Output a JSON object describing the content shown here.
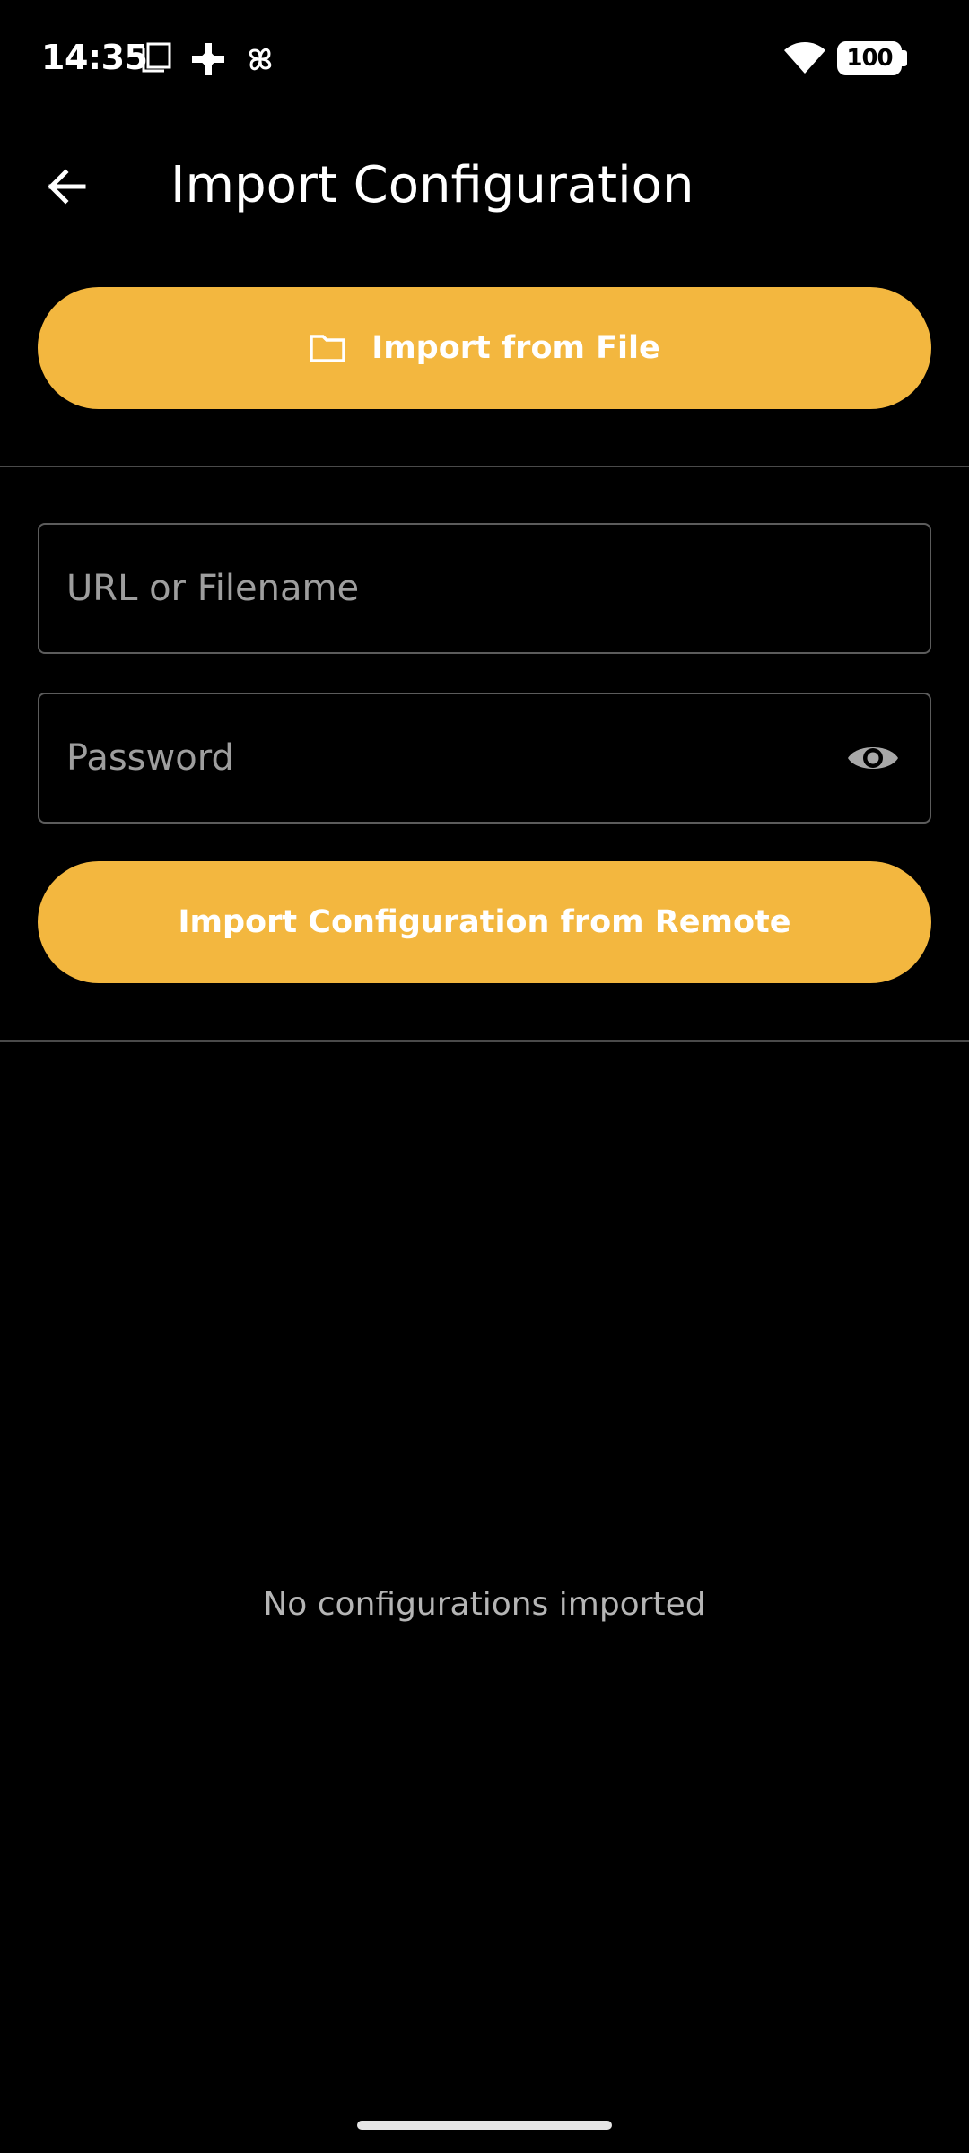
{
  "status_bar": {
    "time": "14:35",
    "icons": [
      "screenshot-icon",
      "plus-icon",
      "pinwheel-icon",
      "wifi-icon",
      "battery-icon"
    ],
    "battery_level": "100"
  },
  "app_bar": {
    "back_icon": "arrow-back-icon",
    "title": "Import Configuration"
  },
  "import_file": {
    "icon": "folder-icon",
    "label": "Import from File"
  },
  "remote": {
    "url_placeholder": "URL or Filename",
    "password_placeholder": "Password",
    "visibility_icon": "eye-icon",
    "button_label": "Import Configuration from Remote"
  },
  "list": {
    "empty_text": "No configurations imported"
  },
  "colors": {
    "accent": "#f3b73f",
    "background": "#000000",
    "divider": "#4a4a4a"
  }
}
